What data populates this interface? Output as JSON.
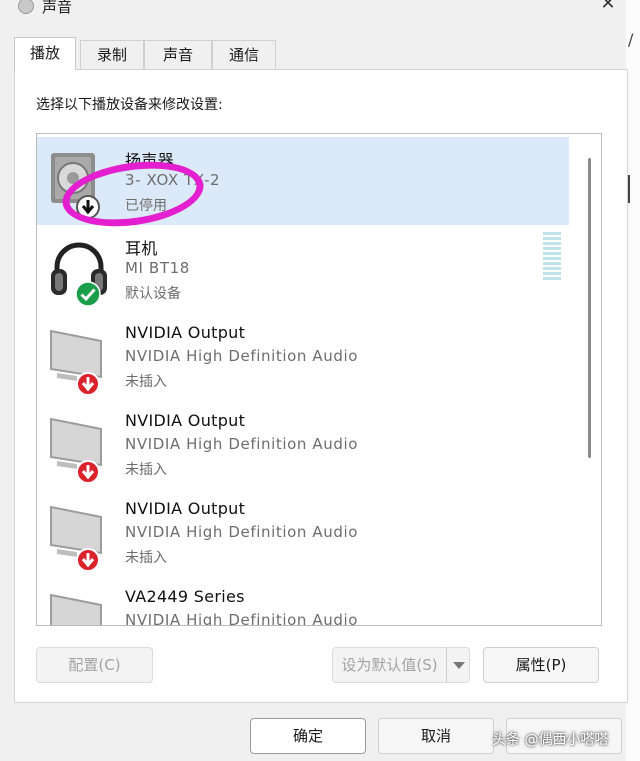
{
  "window": {
    "title": "声音",
    "close_glyph": "✕"
  },
  "tabs": [
    "播放",
    "录制",
    "声音",
    "通信"
  ],
  "instruction": "选择以下播放设备来修改设置:",
  "devices": [
    {
      "name": "扬声器",
      "description": "3- XOX TX-2",
      "status": "已停用",
      "icon": "speaker-icon",
      "badge": "disabled-badge-icon",
      "selected": true
    },
    {
      "name": "耳机",
      "description": "MI BT18",
      "status": "默认设备",
      "icon": "headphones-icon",
      "badge": "default-check-icon",
      "selected": false
    },
    {
      "name": "NVIDIA Output",
      "description": "NVIDIA High Definition Audio",
      "status": "未插入",
      "icon": "monitor-icon",
      "badge": "unplugged-badge-icon",
      "selected": false
    },
    {
      "name": "NVIDIA Output",
      "description": "NVIDIA High Definition Audio",
      "status": "未插入",
      "icon": "monitor-icon",
      "badge": "unplugged-badge-icon",
      "selected": false
    },
    {
      "name": "NVIDIA Output",
      "description": "NVIDIA High Definition Audio",
      "status": "未插入",
      "icon": "monitor-icon",
      "badge": "unplugged-badge-icon",
      "selected": false
    },
    {
      "name": "VA2449 Series",
      "description": "NVIDIA High Definition Audio",
      "status": "",
      "icon": "monitor-icon",
      "badge": "",
      "selected": false
    }
  ],
  "buttons": {
    "configure": "配置(C)",
    "set_default": "设为默认值(S)",
    "properties": "属性(P)",
    "ok": "确定",
    "cancel": "取消"
  },
  "watermark": "头条 @偶西小嗒嗒",
  "colors": {
    "selection": "#dce9f8",
    "highlight_circle": "#e31fd0",
    "badge_green": "#1a9e4a",
    "badge_red": "#d9222a"
  }
}
